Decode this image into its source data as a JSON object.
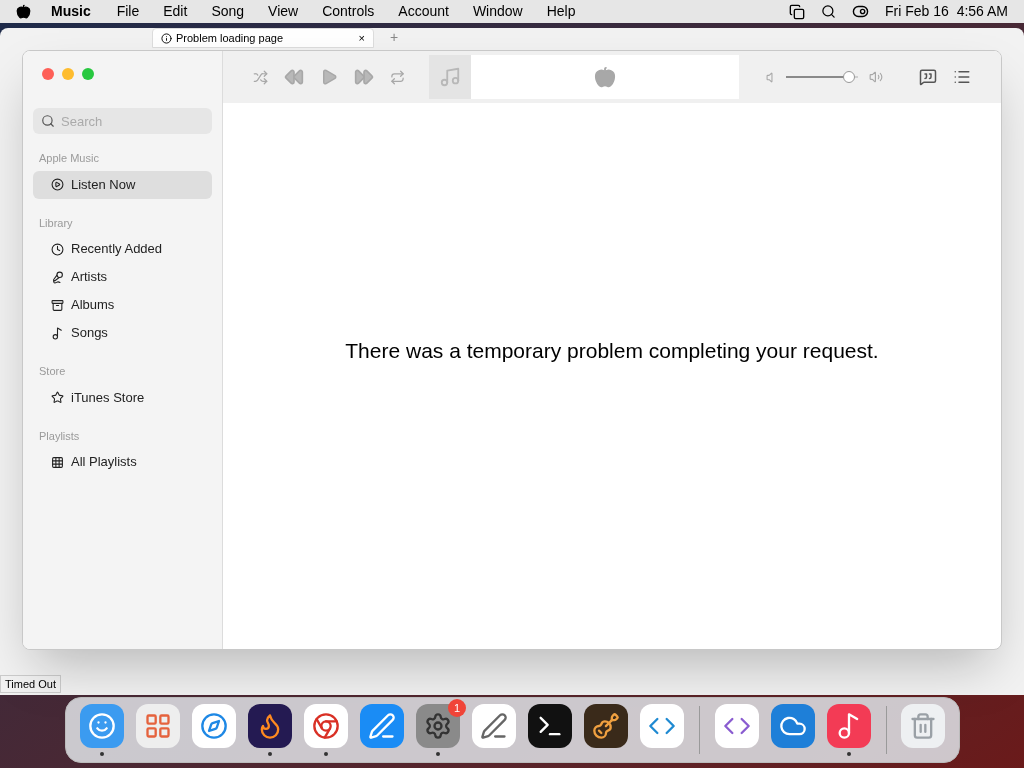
{
  "menu_bar": {
    "app_name": "Music",
    "menus": [
      "File",
      "Edit",
      "Song",
      "View",
      "Controls",
      "Account",
      "Window",
      "Help"
    ],
    "clock": "Fri Feb 16  4:56 AM"
  },
  "background_window": {
    "tab_title": "Problem loading page",
    "tab_close": "×",
    "new_tab": "+",
    "status": "Timed Out"
  },
  "music_window": {
    "volume": {
      "level": 0.88
    },
    "search": {
      "placeholder": "Search"
    },
    "sidebar": [
      {
        "title": "Apple Music",
        "items": [
          {
            "label": "Listen Now",
            "selected": true
          }
        ]
      },
      {
        "title": "Library",
        "items": [
          {
            "label": "Recently Added",
            "selected": false
          },
          {
            "label": "Artists",
            "selected": false
          },
          {
            "label": "Albums",
            "selected": false
          },
          {
            "label": "Songs",
            "selected": false
          }
        ]
      },
      {
        "title": "Store",
        "items": [
          {
            "label": "iTunes Store",
            "selected": false
          }
        ]
      },
      {
        "title": "Playlists",
        "items": [
          {
            "label": "All Playlists",
            "selected": false
          }
        ]
      }
    ],
    "message": "There was a temporary problem completing your request."
  },
  "dock": {
    "groups": [
      [
        {
          "running": true
        },
        {
          "running": false
        },
        {
          "running": false
        },
        {
          "running": true
        },
        {
          "running": true
        },
        {
          "running": false
        },
        {
          "running": true,
          "badge": "1"
        },
        {
          "running": false
        },
        {
          "running": false
        },
        {
          "running": false
        },
        {
          "running": false
        }
      ],
      [
        {
          "running": false
        },
        {
          "running": false
        },
        {
          "running": true
        }
      ],
      [
        {
          "running": false
        }
      ]
    ]
  }
}
